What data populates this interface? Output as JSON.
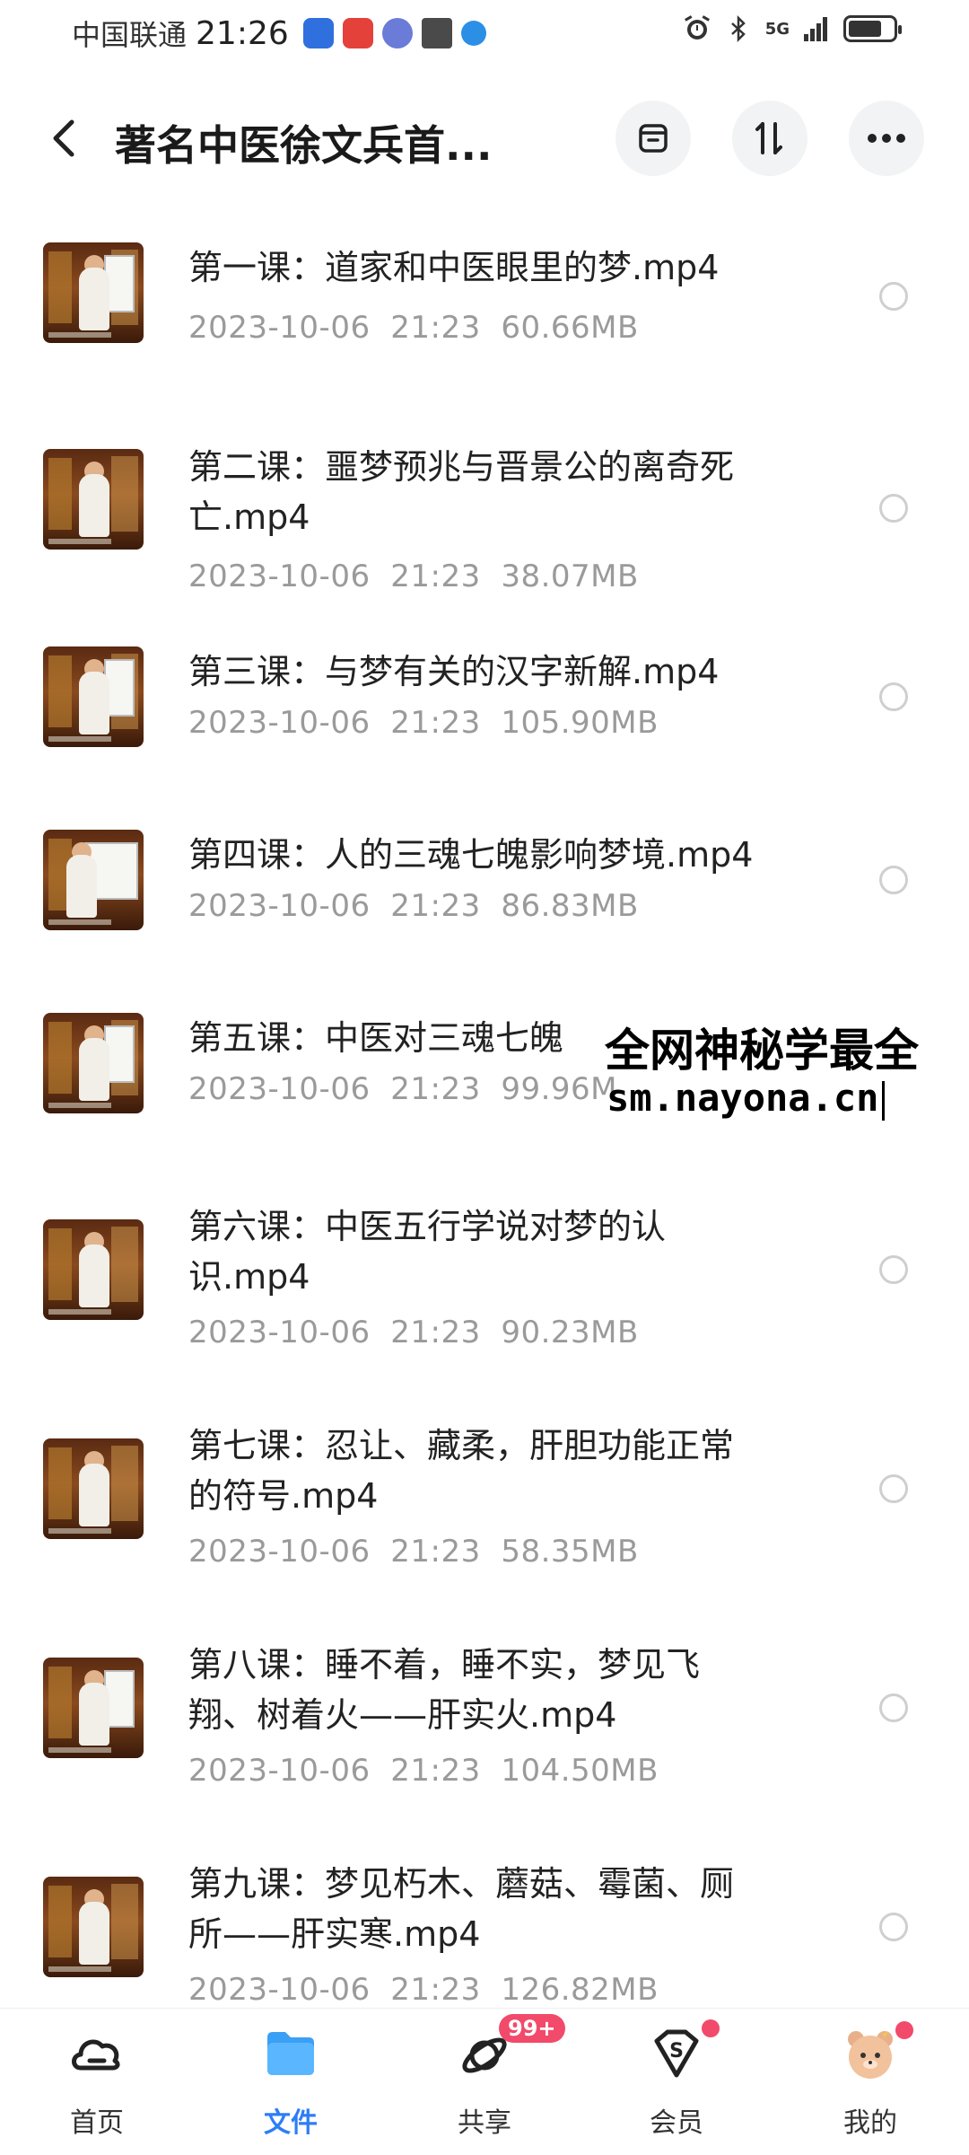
{
  "status_bar": {
    "carrier": "中国联通",
    "time": "21:26",
    "network": "5G"
  },
  "header": {
    "title": "著名中医徐文兵首..."
  },
  "files": [
    {
      "name_line1": "第一课：道家和中医眼里的梦.mp4",
      "name_line2": "",
      "date": "2023-10-06",
      "time": "21:23",
      "size": "60.66MB"
    },
    {
      "name_line1": "第二课：噩梦预兆与晋景公的离奇死",
      "name_line2": "亡.mp4",
      "date": "2023-10-06",
      "time": "21:23",
      "size": "38.07MB"
    },
    {
      "name_line1": "第三课：与梦有关的汉字新解.mp4",
      "name_line2": "",
      "date": "2023-10-06",
      "time": "21:23",
      "size": "105.90MB"
    },
    {
      "name_line1": "第四课：人的三魂七魄影响梦境.mp4",
      "name_line2": "",
      "date": "2023-10-06",
      "time": "21:23",
      "size": "86.83MB"
    },
    {
      "name_line1": "第五课：中医对三魂七魄",
      "name_line2": "",
      "date": "2023-10-06",
      "time": "21:23",
      "size": "99.96M"
    },
    {
      "name_line1": "第六课：中医五行学说对梦的认",
      "name_line2": "识.mp4",
      "date": "2023-10-06",
      "time": "21:23",
      "size": "90.23MB"
    },
    {
      "name_line1": "第七课：忍让、藏柔，肝胆功能正常",
      "name_line2": "的符号.mp4",
      "date": "2023-10-06",
      "time": "21:23",
      "size": "58.35MB"
    },
    {
      "name_line1": "第八课：睡不着，睡不实，梦见飞",
      "name_line2": "翔、树着火——肝实火.mp4",
      "date": "2023-10-06",
      "time": "21:23",
      "size": "104.50MB"
    },
    {
      "name_line1": "第九课：梦见朽木、蘑菇、霉菌、厕",
      "name_line2": "所——肝实寒.mp4",
      "date": "2023-10-06",
      "time": "21:23",
      "size": "126.82MB"
    }
  ],
  "watermark": {
    "line1": "全网神秘学最全",
    "line2": "sm.nayona.cn"
  },
  "bottom_nav": {
    "items": [
      {
        "label": "首页",
        "icon": "cloud-home-icon"
      },
      {
        "label": "文件",
        "icon": "folder-icon"
      },
      {
        "label": "共享",
        "icon": "share-orbit-icon",
        "badge": "99+"
      },
      {
        "label": "会员",
        "icon": "vip-diamond-icon"
      },
      {
        "label": "我的",
        "icon": "bear-avatar-icon"
      }
    ],
    "active_color": "#2e7df6"
  }
}
